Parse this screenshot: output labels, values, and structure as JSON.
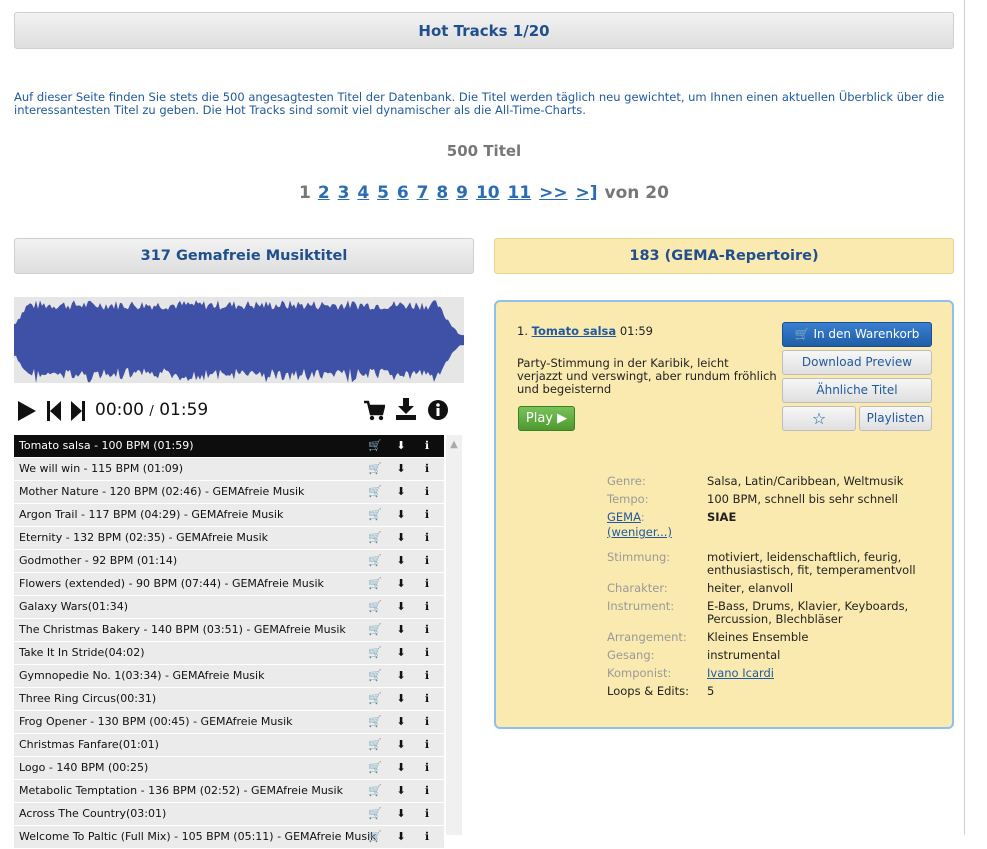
{
  "header": {
    "title": "Hot Tracks 1/20"
  },
  "intro": "Auf dieser Seite finden Sie stets die 500 angesagtesten Titel der Datenbank. Die Titel werden täglich neu gewichtet, um Ihnen einen aktuellen Überblick über die interessantesten Titel zu geben. Die Hot Tracks sind somit viel dynamischer als die All-Time-Charts.",
  "count": "500 Titel",
  "pager": {
    "current": "1",
    "pages": [
      "2",
      "3",
      "4",
      "5",
      "6",
      "7",
      "8",
      "9",
      "10",
      "11"
    ],
    "next": ">>",
    "last": ">]",
    "of": "von 20"
  },
  "tabs": {
    "gemafrei": "317 Gemafreie Musiktitel",
    "gema": "183 (GEMA-Repertoire)"
  },
  "player": {
    "current_time": "00:00",
    "separator": "/",
    "total_time": "01:59"
  },
  "tracks": [
    "Tomato salsa - 100 BPM (01:59)",
    "We will win - 115 BPM (01:09)",
    "Mother Nature - 120 BPM (02:46) - GEMAfreie Musik",
    "Argon Trail - 117 BPM (04:29) - GEMAfreie Musik",
    "Eternity - 132 BPM (02:35) - GEMAfreie Musik",
    "Godmother - 92 BPM (01:14)",
    "Flowers (extended) - 90 BPM (07:44) - GEMAfreie Musik",
    "Galaxy Wars(01:34)",
    "The Christmas Bakery - 140 BPM (03:51) - GEMAfreie Musik",
    "Take It In Stride(04:02)",
    "Gymnopedie No. 1(03:34) - GEMAfreie Musik",
    "Three Ring Circus(00:31)",
    "Frog Opener - 130 BPM (00:45) - GEMAfreie Musik",
    "Christmas Fanfare(01:01)",
    "Logo - 140 BPM (00:25)",
    "Metabolic Temptation - 136 BPM (02:52) - GEMAfreie Musik",
    "Across The Country(03:01)",
    "Welcome To Paltic (Full Mix) - 105 BPM (05:11) - GEMAfreie Musik"
  ],
  "detail": {
    "number": "1.",
    "title": "Tomato salsa",
    "duration": "01:59",
    "description": "Party-Stimmung in der Karibik, leicht verjazzt und verswingt, aber rundum fröhlich und begeisternd",
    "play_label": "Play ▶",
    "cart_label": "In den Warenkorb",
    "preview_label": "Download Preview",
    "similar_label": "Ähnliche Titel",
    "playlist_label": "Playlisten",
    "info": {
      "genre_key": "Genre:",
      "genre_val": "Salsa, Latin/Caribbean, Weltmusik",
      "tempo_key": "Tempo:",
      "tempo_val": "100 BPM, schnell bis sehr schnell",
      "gema_key": "GEMA",
      "gema_colon": ":",
      "gema_val": "SIAE",
      "less_link": "(weniger...)",
      "mood_key": "Stimmung:",
      "mood_val": "motiviert, leidenschaftlich, feurig, enthusiastisch, fit, temperamentvoll",
      "char_key": "Charakter:",
      "char_val": "heiter, elanvoll",
      "instr_key": "Instrument:",
      "instr_val": "E-Bass, Drums, Klavier, Keyboards, Percussion, Blechbläser",
      "arr_key": "Arrangement:",
      "arr_val": "Kleines Ensemble",
      "vocal_key": "Gesang:",
      "vocal_val": "instrumental",
      "comp_key": "Komponist:",
      "comp_val": "Ivano Icardi",
      "loops_key": "Loops & Edits:",
      "loops_val": "5"
    }
  },
  "colors": {
    "accent": "#1f5aa0",
    "waveform": "#3f51a6",
    "gema_bg": "#fbeaaf"
  }
}
